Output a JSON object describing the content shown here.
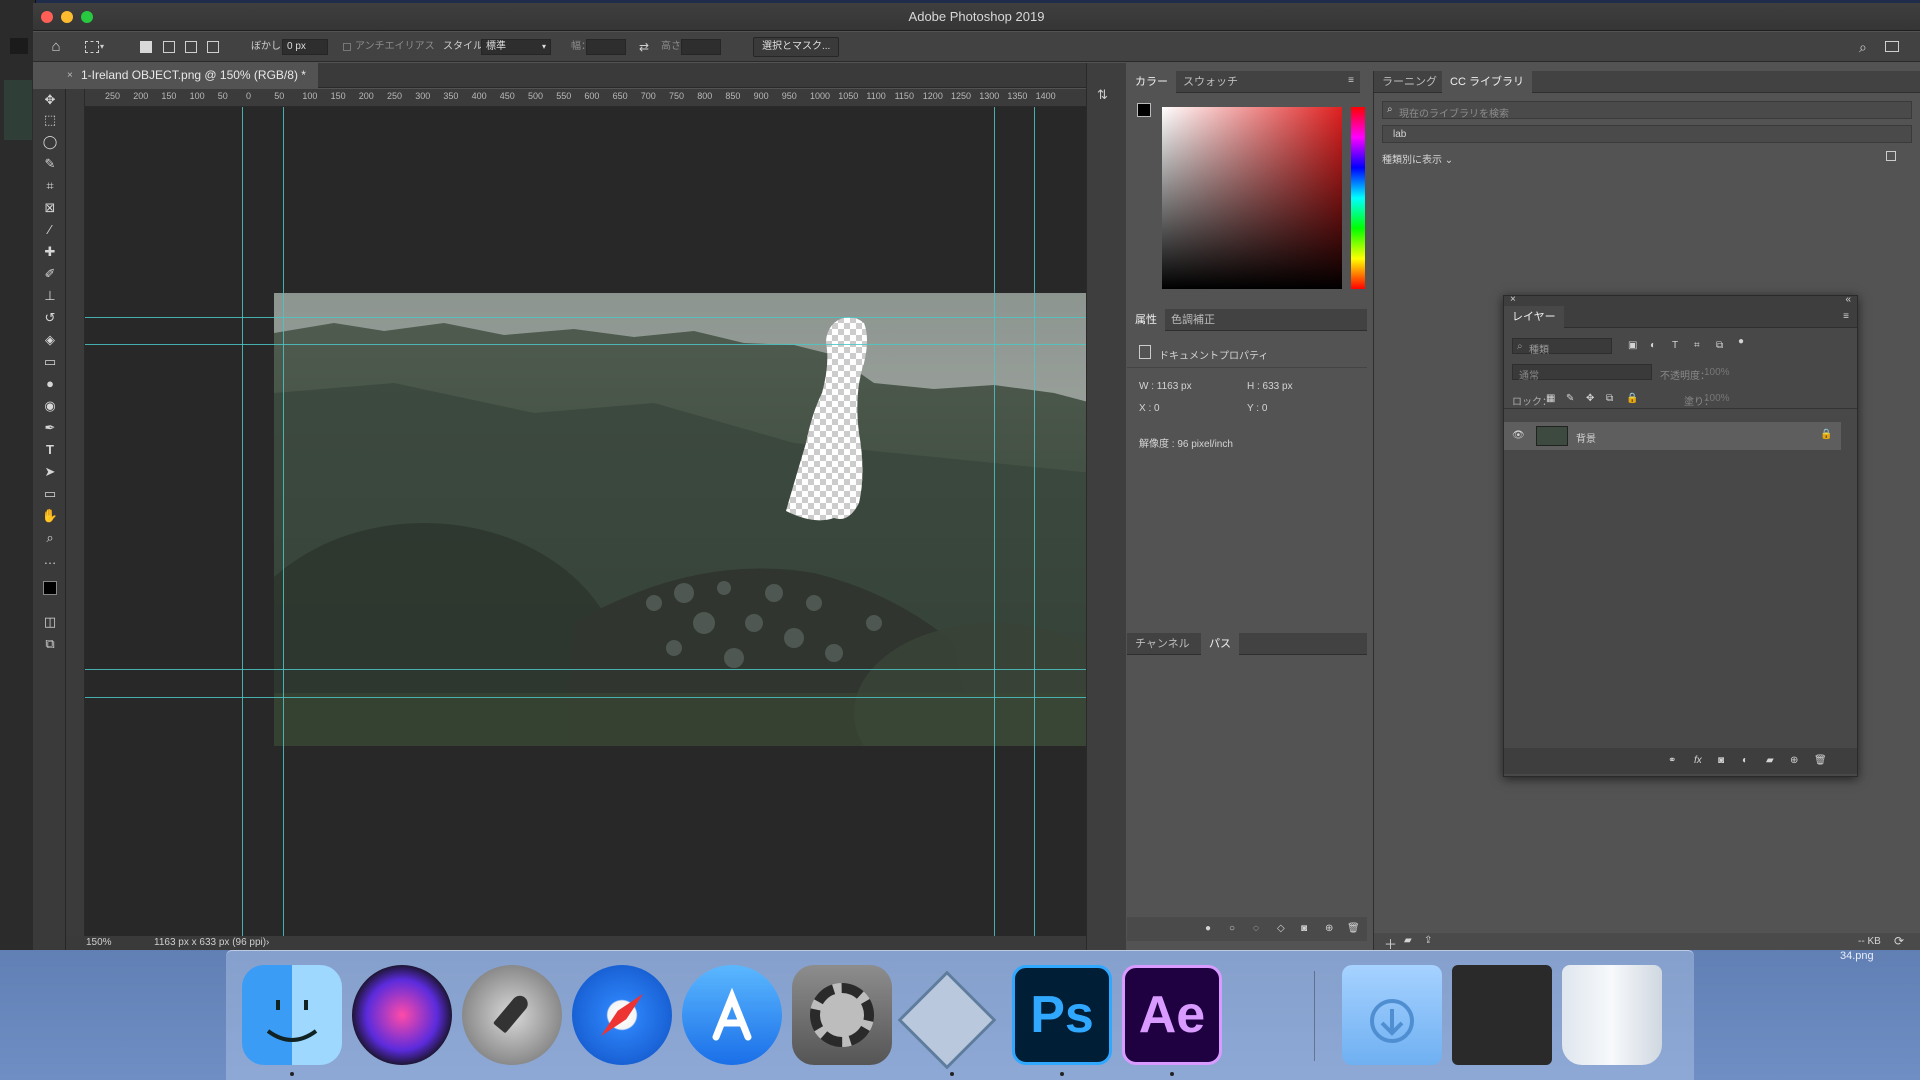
{
  "window": {
    "title": "Adobe Photoshop 2019"
  },
  "options": {
    "feather_label": "ぼかし：",
    "feather_value": "0 px",
    "antialias_label": "アンチエイリアス",
    "style_label": "スタイル：",
    "style_value": "標準",
    "width_label": "幅：",
    "height_label": "高さ：",
    "select_mask_button": "選択とマスク..."
  },
  "document": {
    "tab_label": "1-Ireland OBJECT.png @ 150% (RGB/8) *",
    "zoom": "150%",
    "doc_info": "1163 px x 633 px (96 ppi)"
  },
  "ruler": {
    "top_labels": [
      "250",
      "200",
      "150",
      "100",
      "50",
      "0",
      "50",
      "100",
      "150",
      "200",
      "250",
      "300",
      "350",
      "400",
      "450",
      "500",
      "550",
      "600",
      "650",
      "700",
      "750",
      "800",
      "850",
      "900",
      "950",
      "1000",
      "1050",
      "1100",
      "1150",
      "1200",
      "1250",
      "1300",
      "1350",
      "1400"
    ]
  },
  "color_panel": {
    "tabs": [
      "カラー",
      "スウォッチ"
    ]
  },
  "library_panel": {
    "tabs": [
      "ラーニング",
      "CC ライブラリ"
    ],
    "search_placeholder": "現在のライブラリを検索",
    "library_name": "lab",
    "view_label": "種類別に表示"
  },
  "properties_panel": {
    "tabs": [
      "属性",
      "色調補正"
    ],
    "section_title": "ドキュメントプロパティ",
    "w_label": "W : 1163 px",
    "h_label": "H : 633 px",
    "x_label": "X : 0",
    "y_label": "Y : 0",
    "resolution": "解像度 : 96 pixel/inch"
  },
  "channels_panel": {
    "tabs": [
      "チャンネル",
      "パス"
    ]
  },
  "layers_panel": {
    "title": "レイヤー",
    "filter_label": "種類",
    "blend_mode": "通常",
    "opacity_label": "不透明度：",
    "opacity_value": "100%",
    "lock_label": "ロック：",
    "fill_label": "塗り：",
    "fill_value": "100%",
    "layer_name": "背景"
  },
  "right_bottom": {
    "size": "-- KB"
  },
  "desktop": {
    "file_label": "34.png"
  },
  "dock": {
    "apps": [
      "Finder",
      "Siri",
      "Launchpad",
      "Safari",
      "App Store",
      "System Preferences",
      "Xcode",
      "Photoshop",
      "After Effects",
      "Downloads",
      "Screenshot",
      "Trash"
    ],
    "ps_text": "Ps",
    "ae_text": "Ae"
  },
  "colors": {
    "guide": "#4cc6c6",
    "ps_dark": "#001e36",
    "ps_text": "#31a8ff",
    "ae_dark": "#1f0040",
    "ae_text": "#d99bff"
  }
}
